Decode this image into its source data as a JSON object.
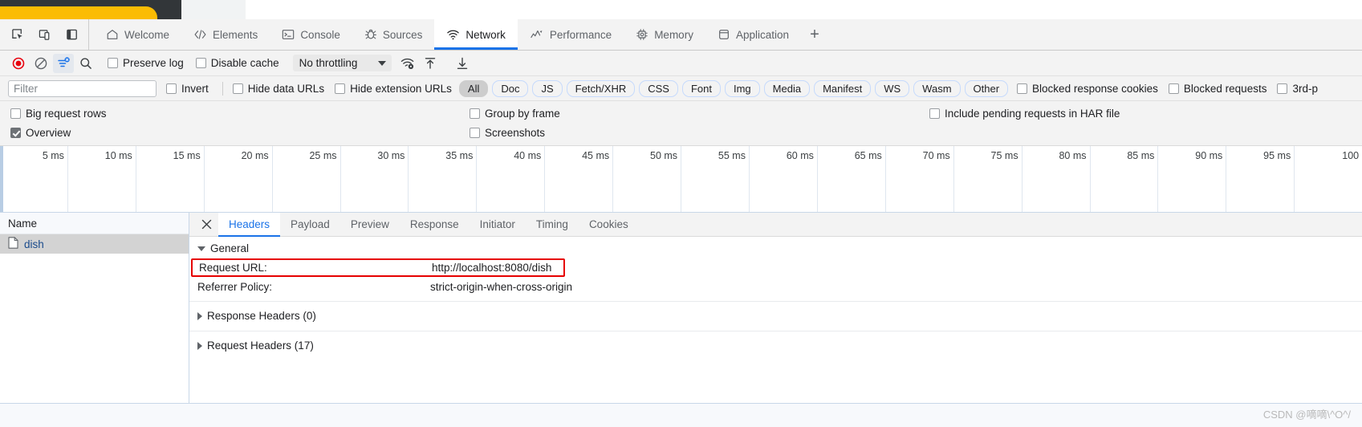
{
  "browser": {
    "tab_strip_color": "#fbbc04",
    "chrome_bg": "#323639"
  },
  "devtools": {
    "dock_icons": [
      {
        "name": "inspect-element-icon",
        "title": "Inspect"
      },
      {
        "name": "device-toolbar-icon",
        "title": "Toggle device toolbar"
      },
      {
        "name": "dock-side-icon",
        "title": "Dock side"
      }
    ],
    "tabs": [
      {
        "label": "Welcome",
        "icon": "home-icon",
        "active": false
      },
      {
        "label": "Elements",
        "icon": "code-brackets-icon",
        "active": false
      },
      {
        "label": "Console",
        "icon": "console-prompt-icon",
        "active": false
      },
      {
        "label": "Sources",
        "icon": "bug-icon",
        "active": false
      },
      {
        "label": "Network",
        "icon": "wifi-icon",
        "active": true
      },
      {
        "label": "Performance",
        "icon": "performance-icon",
        "active": false
      },
      {
        "label": "Memory",
        "icon": "memory-chip-icon",
        "active": false
      },
      {
        "label": "Application",
        "icon": "database-icon",
        "active": false
      }
    ],
    "more_tabs_label": "+",
    "accent_color": "#1a73e8"
  },
  "network_toolbar": {
    "record_button": {
      "name": "record-button",
      "state": "recording",
      "color": "#e8000d"
    },
    "clear_button": {
      "name": "clear-button"
    },
    "filter_toggle": {
      "name": "filter-toggle-button",
      "toggled": true
    },
    "search_button": {
      "name": "search-button"
    },
    "preserve_log": {
      "label": "Preserve log",
      "checked": false
    },
    "disable_cache": {
      "label": "Disable cache",
      "checked": false
    },
    "throttling": {
      "value": "No throttling"
    },
    "network_conditions_button": {
      "name": "network-conditions-icon"
    },
    "import_har_button": {
      "name": "import-har-icon"
    },
    "export_har_button": {
      "name": "export-har-icon"
    }
  },
  "filter_bar": {
    "filter_placeholder": "Filter",
    "filter_value": "",
    "invert": {
      "label": "Invert",
      "checked": false
    },
    "hide_data_urls": {
      "label": "Hide data URLs",
      "checked": false
    },
    "hide_extension_urls": {
      "label": "Hide extension URLs",
      "checked": false
    },
    "type_buttons": [
      {
        "label": "All",
        "selected": true
      },
      {
        "label": "Doc",
        "selected": false
      },
      {
        "label": "JS",
        "selected": false
      },
      {
        "label": "Fetch/XHR",
        "selected": false
      },
      {
        "label": "CSS",
        "selected": false
      },
      {
        "label": "Font",
        "selected": false
      },
      {
        "label": "Img",
        "selected": false
      },
      {
        "label": "Media",
        "selected": false
      },
      {
        "label": "Manifest",
        "selected": false
      },
      {
        "label": "WS",
        "selected": false
      },
      {
        "label": "Wasm",
        "selected": false
      },
      {
        "label": "Other",
        "selected": false
      }
    ],
    "blocked_response_cookies": {
      "label": "Blocked response cookies",
      "checked": false
    },
    "blocked_requests": {
      "label": "Blocked requests",
      "checked": false
    },
    "third_party": {
      "label": "3rd-p",
      "checked": false
    }
  },
  "settings": {
    "big_request_rows": {
      "label": "Big request rows",
      "checked": false
    },
    "group_by_frame": {
      "label": "Group by frame",
      "checked": false
    },
    "include_pending_har": {
      "label": "Include pending requests in HAR file",
      "checked": false
    },
    "overview": {
      "label": "Overview",
      "checked": true
    },
    "screenshots": {
      "label": "Screenshots",
      "checked": false
    }
  },
  "overview_timeline": {
    "ticks": [
      "5 ms",
      "10 ms",
      "15 ms",
      "20 ms",
      "25 ms",
      "30 ms",
      "35 ms",
      "40 ms",
      "45 ms",
      "50 ms",
      "55 ms",
      "60 ms",
      "65 ms",
      "70 ms",
      "75 ms",
      "80 ms",
      "85 ms",
      "90 ms",
      "95 ms",
      "100"
    ]
  },
  "request_list": {
    "column_header": "Name",
    "rows": [
      {
        "name": "dish",
        "icon": "document-icon",
        "selected": true
      }
    ]
  },
  "details_panel": {
    "close_label": "×",
    "tabs": [
      {
        "label": "Headers",
        "active": true
      },
      {
        "label": "Payload",
        "active": false
      },
      {
        "label": "Preview",
        "active": false
      },
      {
        "label": "Response",
        "active": false
      },
      {
        "label": "Initiator",
        "active": false
      },
      {
        "label": "Timing",
        "active": false
      },
      {
        "label": "Cookies",
        "active": false
      }
    ],
    "general": {
      "section_label": "General",
      "expanded": true,
      "rows": [
        {
          "key": "Request URL:",
          "value": "http://localhost:8080/dish",
          "highlighted": true
        },
        {
          "key": "Referrer Policy:",
          "value": "strict-origin-when-cross-origin",
          "highlighted": false
        }
      ]
    },
    "response_headers": {
      "label": "Response Headers (0)",
      "expanded": false
    },
    "request_headers": {
      "label": "Request Headers (17)",
      "expanded": false
    },
    "highlight_color": "#e60000"
  },
  "watermark": {
    "text": "CSDN @嘀嘀\\^O^/"
  }
}
